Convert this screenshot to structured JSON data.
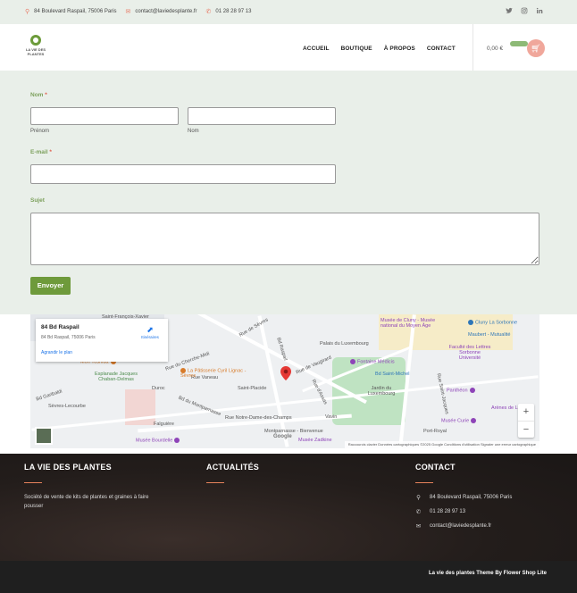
{
  "topbar": {
    "address": "84 Boulevard Raspail, 75006 Paris",
    "email": "contact@laviedesplante.fr",
    "phone": "01 28 28 97 13",
    "social": [
      "twitter-icon",
      "instagram-icon",
      "linkedin-icon"
    ]
  },
  "header": {
    "logo_line1": "LA VIE DES",
    "logo_line2": "PLANTES",
    "nav": [
      "ACCUEIL",
      "BOUTIQUE",
      "À PROPOS",
      "CONTACT"
    ],
    "cart_total": "0,00 €"
  },
  "form": {
    "name_label": "Nom",
    "required_mark": "*",
    "first_name_sub": "Prénom",
    "last_name_sub": "Nom",
    "email_label": "E-mail",
    "subject_label": "Sujet",
    "submit_label": "Envoyer"
  },
  "map": {
    "card_title": "84 Bd Raspail",
    "card_address": "84 Bd Raspail, 75006 Paris",
    "card_directions": "Itinéraires",
    "card_larger": "Agrandir le plan",
    "streets": [
      "Rue de Sèvres",
      "Bd Raspail",
      "Rue de Vaugirard",
      "Rue Notre-Dame-des-Champs",
      "Bd du Montparnasse",
      "Bd Garibaldi",
      "Rue Vaneau",
      "Rue du Cherche-Midi",
      "Rue d'Assas",
      "Rue Saint-Jacques"
    ],
    "places": [
      "Palais du Luxembourg",
      "Jardin du Luxembourg",
      "Fontaine Médicis",
      "Bd Saint-Michel",
      "Musée de Cluny - Musée national du Moyen Âge",
      "Cluny La Sorbonne",
      "Maubert - Mutualité",
      "Faculté des Lettres Sorbonne Université",
      "Panthéon",
      "Musée Curie",
      "Arènes de Lutèce",
      "Saint-Placide",
      "Notre-Dame-des-Champs",
      "Montparnasse - Bienvenue",
      "Vavin",
      "Musée Bourdelle",
      "Musée Zadkine",
      "Falguière",
      "Duroc",
      "Sèvres-Lecourbe",
      "Esplanade Jacques Chaban-Delmas",
      "Mori Yoshida",
      "La Pâtisserie Cyril Lignac - Sèvres",
      "Saint-François-Xavier",
      "Port-Royal"
    ],
    "attribution": "Raccourcis clavier   Données cartographiques ©2025 Google   Conditions d'utilisation   Signaler une erreur cartographique",
    "google": "Google",
    "zoom_in": "+",
    "zoom_out": "−"
  },
  "footer": {
    "col1_title": "LA VIE DES PLANTES",
    "col1_desc": "Société de vente de kits de plantes et graines à faire pousser",
    "col2_title": "ACTUALITÉS",
    "col3_title": "CONTACT",
    "address": "84 Boulevard Raspail, 75006 Paris",
    "phone": "01 28 28 97 13",
    "email": "contact@laviedesplante.fr",
    "credit": "La vie des plantes Theme By Flower Shop Lite"
  },
  "colors": {
    "accent_green": "#6e9a3b",
    "accent_coral": "#f0a79b",
    "footer_bg": "#231d1b"
  }
}
